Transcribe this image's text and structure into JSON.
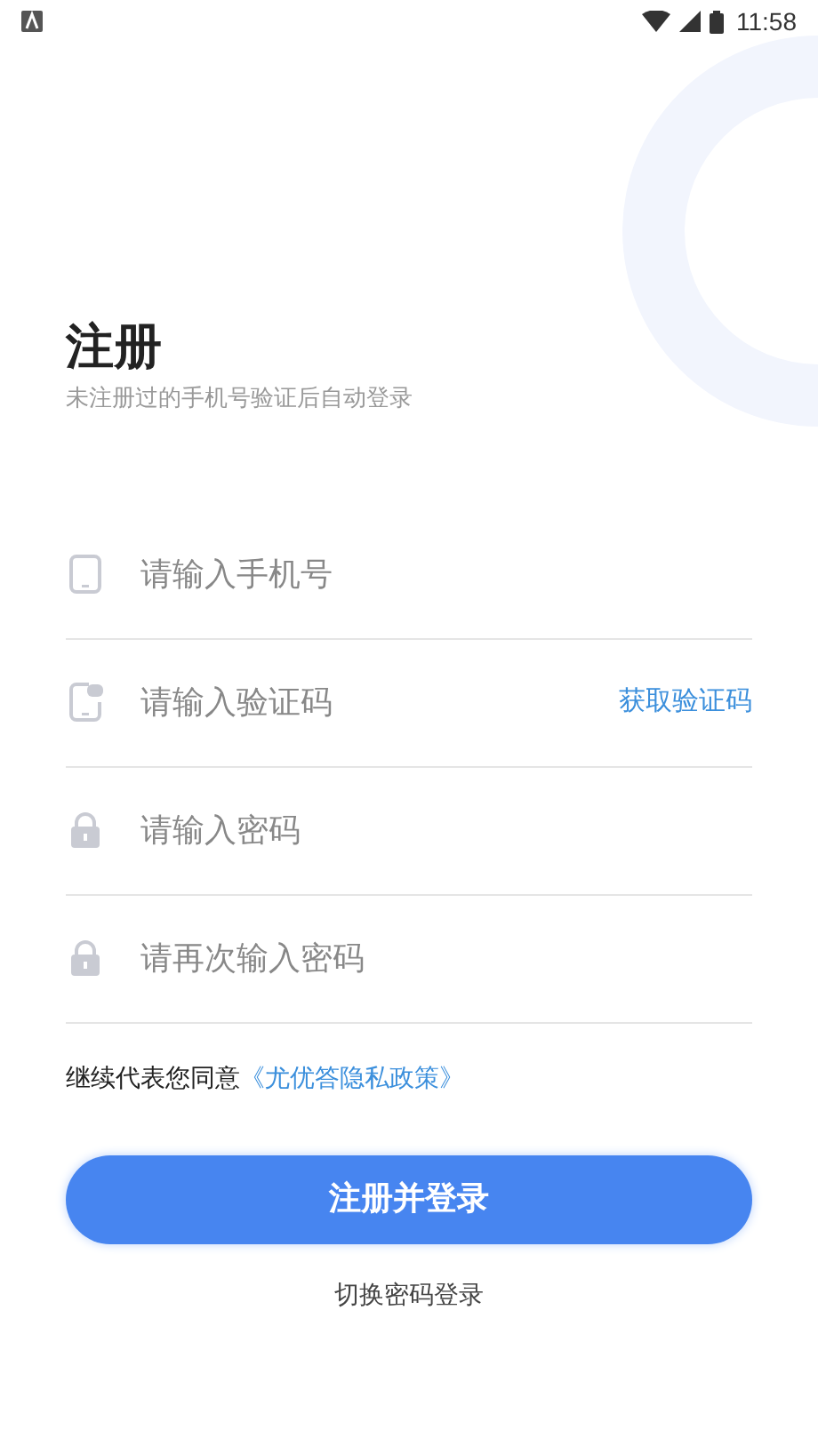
{
  "status_bar": {
    "time": "11:58"
  },
  "title": "注册",
  "subtitle": "未注册过的手机号验证后自动登录",
  "fields": [
    {
      "kind": "phone",
      "placeholder": "请输入手机号"
    },
    {
      "kind": "sms",
      "placeholder": "请输入验证码",
      "action": "获取验证码"
    },
    {
      "kind": "lock",
      "placeholder": "请输入密码"
    },
    {
      "kind": "lock",
      "placeholder": "请再次输入密码"
    }
  ],
  "agreement": {
    "text": "继续代表您同意",
    "link": "《尤优答隐私政策》"
  },
  "submit_button": "注册并登录",
  "switch_link": "切换密码登录"
}
